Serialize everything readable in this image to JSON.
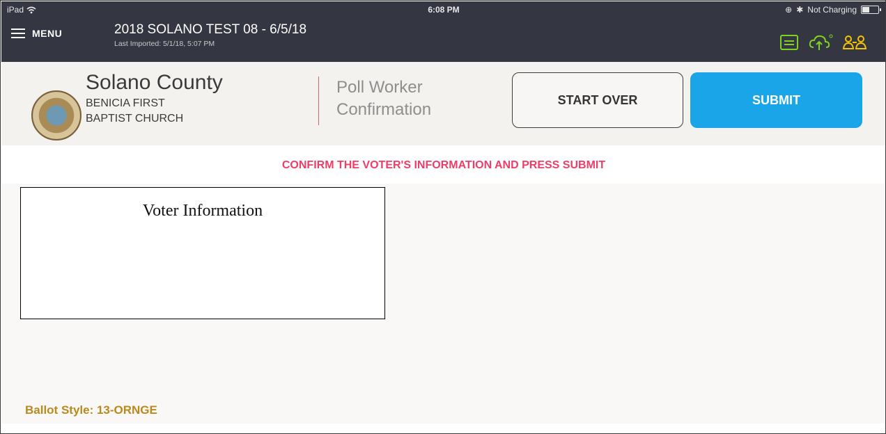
{
  "status_bar": {
    "device": "iPad",
    "time": "6:08 PM",
    "charging": "Not Charging"
  },
  "nav": {
    "menu_label": "MENU",
    "election_title": "2018 SOLANO TEST 08 - 6/5/18",
    "last_imported": "Last Imported: 5/1/18, 5:07 PM",
    "icons": [
      "hamburger-icon",
      "printer-icon",
      "cloud-upload-icon",
      "users-icon"
    ],
    "icon_color": "#7ed321"
  },
  "header": {
    "county": "Solano County",
    "precinct_line1": "BENICIA FIRST",
    "precinct_line2": "BAPTIST CHURCH",
    "page_title_line1": "Poll Worker",
    "page_title_line2": "Confirmation",
    "start_over_label": "START OVER",
    "submit_label": "SUBMIT",
    "submit_color": "#1aa5e8"
  },
  "main": {
    "instruction": "CONFIRM THE VOTER'S INFORMATION AND PRESS SUBMIT",
    "voter_info_title": "Voter Information",
    "ballot_style": "Ballot Style: 13-ORNGE"
  },
  "colors": {
    "instruction": "#ee3d66",
    "ballot_style": "#b88a1d",
    "topbar": "#343641"
  }
}
